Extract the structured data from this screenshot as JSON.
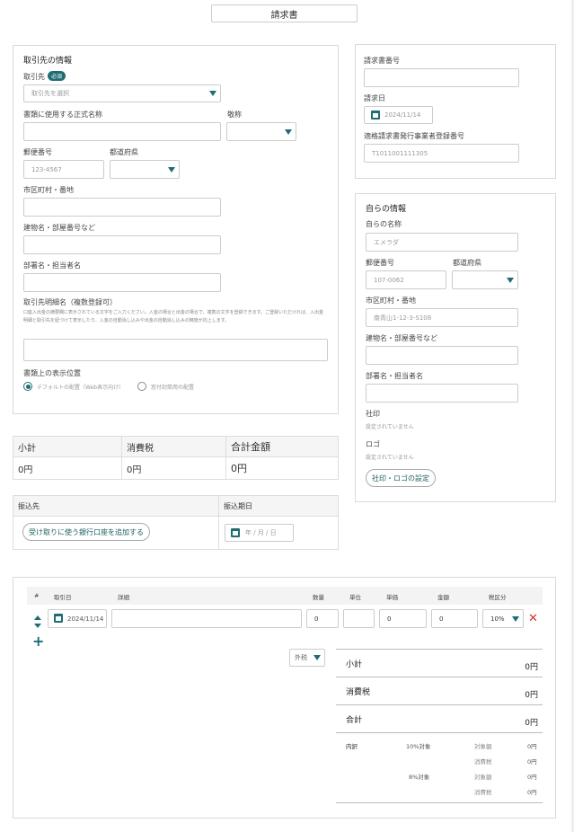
{
  "title": "請求書",
  "client": {
    "section_title": "取引先の情報",
    "client_label": "取引先",
    "required_badge": "必須",
    "client_placeholder": "取引先を選択",
    "official_name_label": "書類に使用する正式名称",
    "honorific_label": "敬称",
    "postal_label": "郵便番号",
    "postal_placeholder": "123-4567",
    "prefecture_label": "都道府県",
    "city_label": "市区町村・番地",
    "building_label": "建物名・部屋番号など",
    "dept_label": "部署名・担当者名",
    "statement_label": "取引先明細名（複数登録可）",
    "statement_note": "口座入出金の摘要欄に表示されている文字をご入力ください。入金の場合と出金の場合で、複数の文字を登録できます。ご登録いただければ、入出金明細と取引先を紐づけて表示したり、入金の自動消し込みや出金の自動消し込みの精度が向上します。",
    "display_position_label": "書類上の表示位置",
    "position_default": "デフォルトの配置（Web表示向け）",
    "position_envelope": "窓付封筒用の配置"
  },
  "invoice_meta": {
    "invoice_no_label": "請求書番号",
    "date_label": "請求日",
    "date_value": "2024/11/14",
    "registration_label": "適格請求書発行事業者登録番号",
    "registration_placeholder": "T1011001111305"
  },
  "self_info": {
    "section_title": "自らの情報",
    "name_label": "自らの名称",
    "name_placeholder": "エメラダ",
    "postal_label": "郵便番号",
    "postal_placeholder": "107-0062",
    "prefecture_label": "都道府県",
    "city_label": "市区町村・番地",
    "city_placeholder": "南青山1-12-3-S108",
    "building_label": "建物名・部屋番号など",
    "dept_label": "部署名・担当者名",
    "seal_label": "社印",
    "seal_value": "設定されていません",
    "logo_label": "ロゴ",
    "logo_value": "設定されていません",
    "seal_logo_button": "社印・ロゴの設定"
  },
  "totals": {
    "subtotal_label": "小計",
    "tax_label": "消費税",
    "total_label": "合計金額",
    "subtotal_value": "0円",
    "tax_value": "0円",
    "total_value": "0円"
  },
  "transfer": {
    "dest_label": "振込先",
    "due_label": "振込期日",
    "add_bank_button": "受け取りに使う銀行口座を追加する",
    "due_placeholder": "年 / 月 / 日"
  },
  "lines": {
    "headers": [
      "#",
      "取引日",
      "詳細",
      "数量",
      "単位",
      "単価",
      "金額",
      "税区分"
    ],
    "row": {
      "date": "2024/11/14",
      "qty": "0",
      "unit_price": "0",
      "amount": "0",
      "tax_rate": "10%"
    },
    "tax_mode": "外税",
    "summary": {
      "subtotal_label": "小計",
      "subtotal_value": "0円",
      "tax_label": "消費税",
      "tax_value": "0円",
      "total_label": "合計",
      "total_value": "0円",
      "breakdown_label": "内訳",
      "rate10_label": "10%対象",
      "rate8_label": "8%対象",
      "taxable_label": "対象額",
      "tax_short_label": "消費税",
      "zero": "0円"
    }
  },
  "colors": {
    "accent": "#1e6d73",
    "delete": "#d9302c"
  }
}
